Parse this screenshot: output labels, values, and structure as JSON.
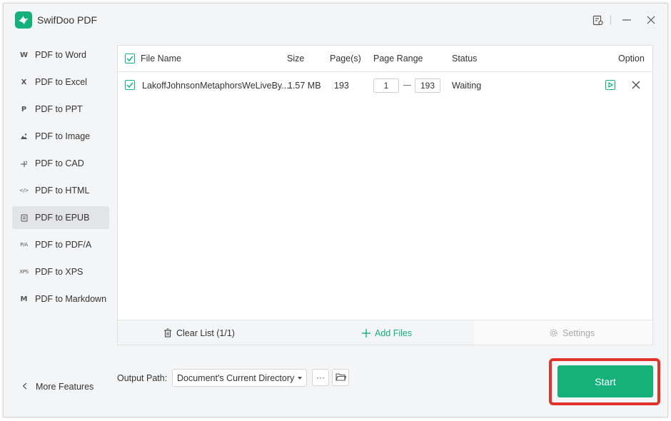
{
  "app": {
    "title": "SwifDoo PDF"
  },
  "sidebar": {
    "items": [
      {
        "icon": "W",
        "label": "PDF to Word",
        "active": false
      },
      {
        "icon": "X",
        "label": "PDF to Excel",
        "active": false
      },
      {
        "icon": "P",
        "label": "PDF to PPT",
        "active": false
      },
      {
        "icon": "image-icon",
        "label": "PDF to Image",
        "active": false
      },
      {
        "icon": "cad-icon",
        "label": "PDF to CAD",
        "active": false
      },
      {
        "icon": "</>",
        "label": "PDF to HTML",
        "active": false
      },
      {
        "icon": "epub-icon",
        "label": "PDF to EPUB",
        "active": true
      },
      {
        "icon": "P/A",
        "label": "PDF to PDF/A",
        "active": false
      },
      {
        "icon": "XPS",
        "label": "PDF to XPS",
        "active": false
      },
      {
        "icon": "M",
        "label": "PDF to Markdown",
        "active": false
      }
    ],
    "more_features": "More Features"
  },
  "table": {
    "headers": {
      "file_name": "File Name",
      "size": "Size",
      "pages": "Page(s)",
      "page_range": "Page Range",
      "status": "Status",
      "option": "Option"
    },
    "rows": [
      {
        "checked": true,
        "file_name": "LakoffJohnsonMetaphorsWeLiveBy....",
        "size": "1.57 MB",
        "pages": "193",
        "range_from": "1",
        "range_to": "193",
        "status": "Waiting"
      }
    ]
  },
  "footer": {
    "clear_list": "Clear List (1/1)",
    "add_files": "Add Files",
    "settings": "Settings"
  },
  "output": {
    "label": "Output Path:",
    "value": "Document's Current Directory",
    "more_label": "···"
  },
  "start": {
    "label": "Start"
  },
  "colors": {
    "accent": "#14b27a",
    "highlight": "#e2332a"
  }
}
